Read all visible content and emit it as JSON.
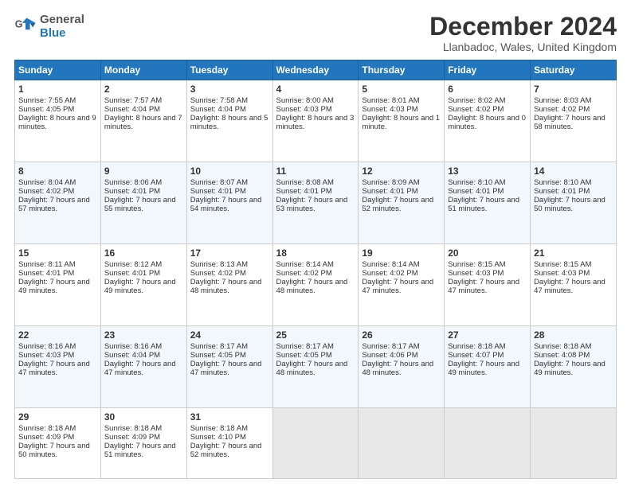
{
  "header": {
    "logo_line1": "General",
    "logo_line2": "Blue",
    "title": "December 2024",
    "subtitle": "Llanbadoc, Wales, United Kingdom"
  },
  "days_of_week": [
    "Sunday",
    "Monday",
    "Tuesday",
    "Wednesday",
    "Thursday",
    "Friday",
    "Saturday"
  ],
  "weeks": [
    [
      {
        "day": "1",
        "rise": "Sunrise: 7:55 AM",
        "set": "Sunset: 4:05 PM",
        "daylight": "Daylight: 8 hours and 9 minutes."
      },
      {
        "day": "2",
        "rise": "Sunrise: 7:57 AM",
        "set": "Sunset: 4:04 PM",
        "daylight": "Daylight: 8 hours and 7 minutes."
      },
      {
        "day": "3",
        "rise": "Sunrise: 7:58 AM",
        "set": "Sunset: 4:04 PM",
        "daylight": "Daylight: 8 hours and 5 minutes."
      },
      {
        "day": "4",
        "rise": "Sunrise: 8:00 AM",
        "set": "Sunset: 4:03 PM",
        "daylight": "Daylight: 8 hours and 3 minutes."
      },
      {
        "day": "5",
        "rise": "Sunrise: 8:01 AM",
        "set": "Sunset: 4:03 PM",
        "daylight": "Daylight: 8 hours and 1 minute."
      },
      {
        "day": "6",
        "rise": "Sunrise: 8:02 AM",
        "set": "Sunset: 4:02 PM",
        "daylight": "Daylight: 8 hours and 0 minutes."
      },
      {
        "day": "7",
        "rise": "Sunrise: 8:03 AM",
        "set": "Sunset: 4:02 PM",
        "daylight": "Daylight: 7 hours and 58 minutes."
      }
    ],
    [
      {
        "day": "8",
        "rise": "Sunrise: 8:04 AM",
        "set": "Sunset: 4:02 PM",
        "daylight": "Daylight: 7 hours and 57 minutes."
      },
      {
        "day": "9",
        "rise": "Sunrise: 8:06 AM",
        "set": "Sunset: 4:01 PM",
        "daylight": "Daylight: 7 hours and 55 minutes."
      },
      {
        "day": "10",
        "rise": "Sunrise: 8:07 AM",
        "set": "Sunset: 4:01 PM",
        "daylight": "Daylight: 7 hours and 54 minutes."
      },
      {
        "day": "11",
        "rise": "Sunrise: 8:08 AM",
        "set": "Sunset: 4:01 PM",
        "daylight": "Daylight: 7 hours and 53 minutes."
      },
      {
        "day": "12",
        "rise": "Sunrise: 8:09 AM",
        "set": "Sunset: 4:01 PM",
        "daylight": "Daylight: 7 hours and 52 minutes."
      },
      {
        "day": "13",
        "rise": "Sunrise: 8:10 AM",
        "set": "Sunset: 4:01 PM",
        "daylight": "Daylight: 7 hours and 51 minutes."
      },
      {
        "day": "14",
        "rise": "Sunrise: 8:10 AM",
        "set": "Sunset: 4:01 PM",
        "daylight": "Daylight: 7 hours and 50 minutes."
      }
    ],
    [
      {
        "day": "15",
        "rise": "Sunrise: 8:11 AM",
        "set": "Sunset: 4:01 PM",
        "daylight": "Daylight: 7 hours and 49 minutes."
      },
      {
        "day": "16",
        "rise": "Sunrise: 8:12 AM",
        "set": "Sunset: 4:01 PM",
        "daylight": "Daylight: 7 hours and 49 minutes."
      },
      {
        "day": "17",
        "rise": "Sunrise: 8:13 AM",
        "set": "Sunset: 4:02 PM",
        "daylight": "Daylight: 7 hours and 48 minutes."
      },
      {
        "day": "18",
        "rise": "Sunrise: 8:14 AM",
        "set": "Sunset: 4:02 PM",
        "daylight": "Daylight: 7 hours and 48 minutes."
      },
      {
        "day": "19",
        "rise": "Sunrise: 8:14 AM",
        "set": "Sunset: 4:02 PM",
        "daylight": "Daylight: 7 hours and 47 minutes."
      },
      {
        "day": "20",
        "rise": "Sunrise: 8:15 AM",
        "set": "Sunset: 4:03 PM",
        "daylight": "Daylight: 7 hours and 47 minutes."
      },
      {
        "day": "21",
        "rise": "Sunrise: 8:15 AM",
        "set": "Sunset: 4:03 PM",
        "daylight": "Daylight: 7 hours and 47 minutes."
      }
    ],
    [
      {
        "day": "22",
        "rise": "Sunrise: 8:16 AM",
        "set": "Sunset: 4:03 PM",
        "daylight": "Daylight: 7 hours and 47 minutes."
      },
      {
        "day": "23",
        "rise": "Sunrise: 8:16 AM",
        "set": "Sunset: 4:04 PM",
        "daylight": "Daylight: 7 hours and 47 minutes."
      },
      {
        "day": "24",
        "rise": "Sunrise: 8:17 AM",
        "set": "Sunset: 4:05 PM",
        "daylight": "Daylight: 7 hours and 47 minutes."
      },
      {
        "day": "25",
        "rise": "Sunrise: 8:17 AM",
        "set": "Sunset: 4:05 PM",
        "daylight": "Daylight: 7 hours and 48 minutes."
      },
      {
        "day": "26",
        "rise": "Sunrise: 8:17 AM",
        "set": "Sunset: 4:06 PM",
        "daylight": "Daylight: 7 hours and 48 minutes."
      },
      {
        "day": "27",
        "rise": "Sunrise: 8:18 AM",
        "set": "Sunset: 4:07 PM",
        "daylight": "Daylight: 7 hours and 49 minutes."
      },
      {
        "day": "28",
        "rise": "Sunrise: 8:18 AM",
        "set": "Sunset: 4:08 PM",
        "daylight": "Daylight: 7 hours and 49 minutes."
      }
    ],
    [
      {
        "day": "29",
        "rise": "Sunrise: 8:18 AM",
        "set": "Sunset: 4:09 PM",
        "daylight": "Daylight: 7 hours and 50 minutes."
      },
      {
        "day": "30",
        "rise": "Sunrise: 8:18 AM",
        "set": "Sunset: 4:09 PM",
        "daylight": "Daylight: 7 hours and 51 minutes."
      },
      {
        "day": "31",
        "rise": "Sunrise: 8:18 AM",
        "set": "Sunset: 4:10 PM",
        "daylight": "Daylight: 7 hours and 52 minutes."
      },
      null,
      null,
      null,
      null
    ]
  ]
}
